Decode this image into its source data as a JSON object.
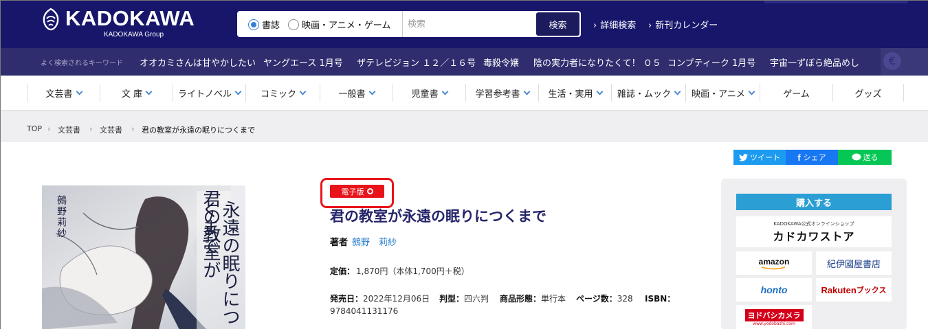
{
  "header": {
    "logo_name": "KADOKAWA",
    "logo_sub": "KADOKAWA Group",
    "search": {
      "radio_books": "書誌",
      "radio_media": "映画・アニメ・ゲーム",
      "placeholder": "検索",
      "button": "検索"
    },
    "advanced_search": "詳細検索",
    "calendar": "新刊カレンダー"
  },
  "keywords": {
    "label": "よく検索されるキーワード",
    "items": [
      "オオカミさんは甘やかしたい",
      "ヤングエース 1月号",
      "ザテレビジョン １２／１６号",
      "毒殺令嬢",
      "陰の実力者になりたくて！ ０５",
      "コンプティーク 1月号",
      "宇宙一ずぼら絶品めし"
    ]
  },
  "categories": [
    "文芸書",
    "文 庫",
    "ライトノベル",
    "コミック",
    "一般書",
    "児童書",
    "学習参考書",
    "生活・実用",
    "雑誌・ムック",
    "映画・アニメ",
    "ゲーム",
    "グッズ"
  ],
  "breadcrumb": {
    "top": "TOP",
    "level1": "文芸書",
    "level2": "文芸書",
    "current": "君の教室が永遠の眠りにつくまで"
  },
  "share": {
    "tweet": "ツイート",
    "share": "シェア",
    "send": "送る"
  },
  "cover": {
    "title_line1": "君の教室が",
    "title_line2": "永遠の眠りにつくまで",
    "author": "鵺野莉紗"
  },
  "product": {
    "badge": "電子版",
    "title": "君の教室が永遠の眠りにつくまで",
    "author_label": "著者",
    "author": "鵺野　莉紗",
    "price_label": "定価：",
    "price": "1,870円（本体1,700円＋税）",
    "release_label": "発売日：",
    "release": "2022年12月06日",
    "format_label": "判型：",
    "format": "四六判",
    "form_label": "商品形態：",
    "form": "単行本",
    "pages_label": "ページ数：",
    "pages": "328",
    "isbn_label": "ISBN：",
    "isbn": "9784041131176"
  },
  "purchase": {
    "heading": "購入する",
    "store_kadokawa_small": "KADOKAWA公式オンラインショップ",
    "store_kadokawa": "カドカワストア",
    "store_amazon": "amazon",
    "store_kinokuniya": "紀伊國屋書店",
    "store_honto": "honto",
    "store_rakuten": "Rakuten",
    "store_rakuten_suffix": "ブックス",
    "store_yodobashi": "ヨドバシカメラ",
    "store_yodobashi_url": "www.yodobashi.com"
  },
  "colors": {
    "header_bg": "#17166b",
    "keyword_bg": "#2f2d6e",
    "title": "#25246a",
    "accent_blue": "#2b9ed4",
    "badge_red": "#e8141a",
    "twitter": "#1d9bf0",
    "facebook": "#1877f2",
    "line": "#06c755"
  }
}
